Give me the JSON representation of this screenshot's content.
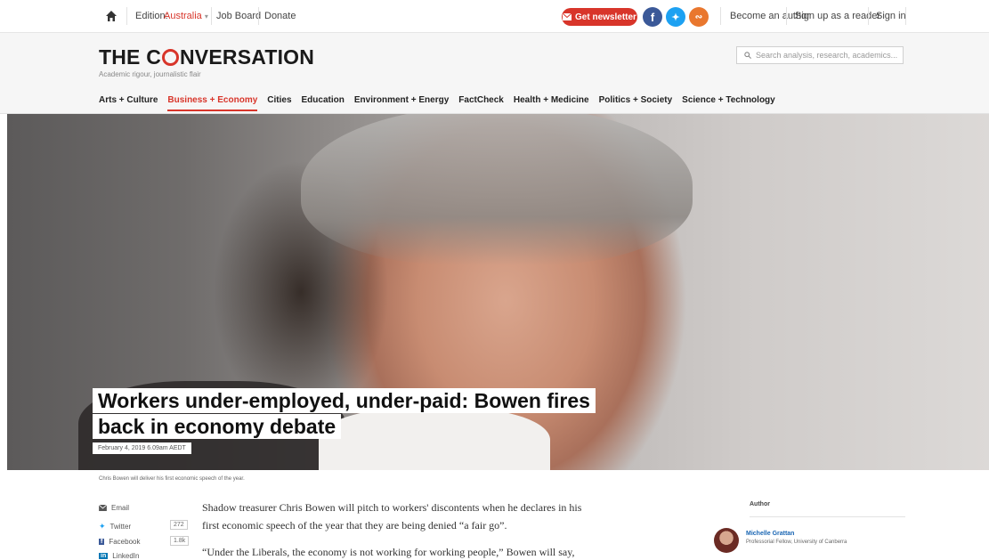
{
  "topbar": {
    "edition_label": "Edition:",
    "edition_value": "Australia",
    "job_board": "Job Board",
    "donate": "Donate",
    "newsletter": "Get newsletter",
    "become_author": "Become an author",
    "sign_up": "Sign up as a reader",
    "sign_in": "Sign in"
  },
  "header": {
    "logo_pre": "THE C",
    "logo_post": "NVERSATION",
    "tagline": "Academic rigour, journalistic flair",
    "search_placeholder": "Search analysis, research, academics..."
  },
  "nav": [
    "Arts + Culture",
    "Business + Economy",
    "Cities",
    "Education",
    "Environment + Energy",
    "FactCheck",
    "Health + Medicine",
    "Politics + Society",
    "Science + Technology"
  ],
  "nav_active": "Business + Economy",
  "article": {
    "title_line1": "Workers under-employed, under-paid: Bowen fires",
    "title_line2": "back in economy debate",
    "date": "February 4, 2019 6.09am AEDT",
    "caption": "Chris Bowen will deliver his first economic speech of the year.",
    "p1_line1": "Shadow treasurer Chris Bowen will pitch to workers' discontents when he declares in his",
    "p1_line2": "first economic speech of the year that they are being denied “a fair go”.",
    "p2_line1": "“Under the Liberals, the economy is not working for working people,” Bowen will say,"
  },
  "share": [
    {
      "label": "Email",
      "count": ""
    },
    {
      "label": "Twitter",
      "count": "272"
    },
    {
      "label": "Facebook",
      "count": "1.8k"
    },
    {
      "label": "LinkedIn",
      "count": ""
    }
  ],
  "author": {
    "heading": "Author",
    "name": "Michelle Grattan",
    "role": "Professorial Fellow, University of Canberra"
  },
  "colors": {
    "accent": "#d8352a",
    "facebook": "#3b5998",
    "twitter": "#1da1f2",
    "rss": "#e9772e",
    "link": "#1a66b3"
  }
}
